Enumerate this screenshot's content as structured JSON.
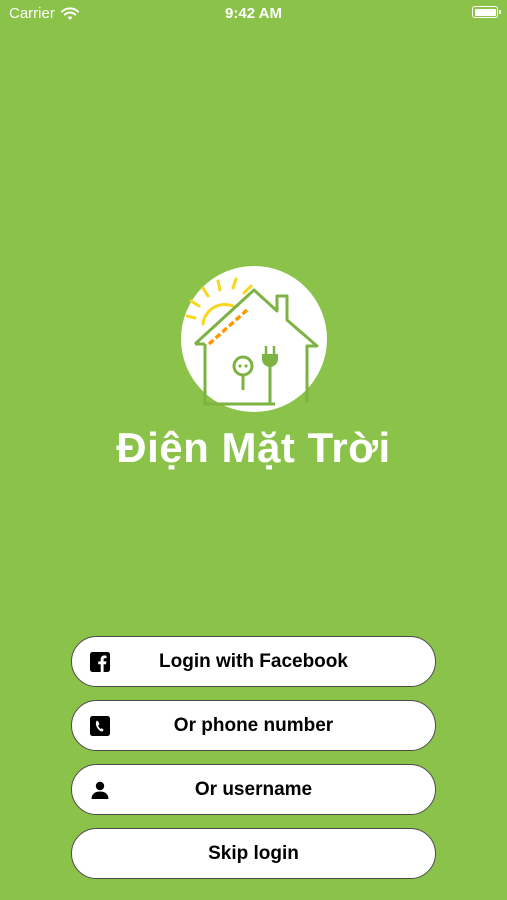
{
  "status_bar": {
    "carrier": "Carrier",
    "time": "9:42 AM",
    "wifi_icon": "wifi-icon",
    "battery_icon": "battery-icon"
  },
  "app": {
    "logo": "solar-house-logo",
    "title": "Điện Mặt Trời"
  },
  "login_buttons": [
    {
      "label": "Login with Facebook",
      "icon": "facebook-icon"
    },
    {
      "label": "Or phone number",
      "icon": "phone-icon"
    },
    {
      "label": "Or username",
      "icon": "user-icon"
    },
    {
      "label": "Skip login",
      "icon": ""
    }
  ],
  "colors": {
    "background": "#8bc34a",
    "button_bg": "#ffffff",
    "button_border": "#4b4b4b",
    "logo_house": "#7cb342",
    "logo_sun": "#f9d71c",
    "logo_panel": "#ff9800"
  }
}
